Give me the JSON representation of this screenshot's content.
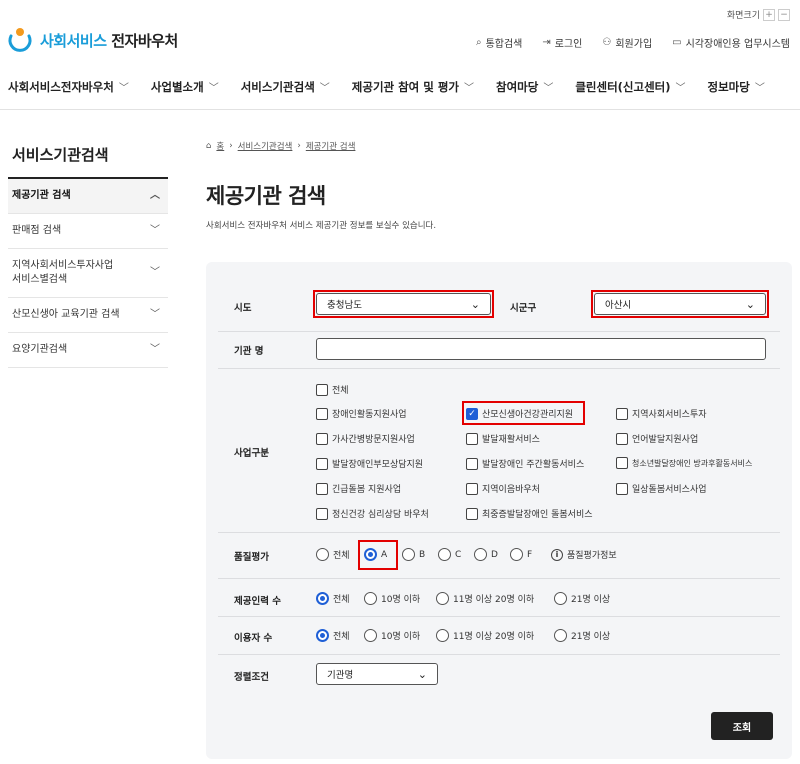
{
  "header": {
    "screen_size_label": "화면크기",
    "zoom_in": "+",
    "zoom_out": "−",
    "logo_part1": "사회서비스",
    "logo_part2": "전자바우처",
    "util": [
      {
        "icon": "search-icon",
        "glyph": "⌕",
        "label": "통합검색"
      },
      {
        "icon": "login-icon",
        "glyph": "⇥",
        "label": "로그인"
      },
      {
        "icon": "user-add-icon",
        "glyph": "⚇",
        "label": "회원가입"
      },
      {
        "icon": "monitor-icon",
        "glyph": "▭",
        "label": "시각장애인용 업무시스템"
      }
    ]
  },
  "nav": [
    "사회서비스전자바우처",
    "사업별소개",
    "서비스기관검색",
    "제공기관 참여 및 평가",
    "참여마당",
    "클린센터(신고센터)",
    "정보마당"
  ],
  "sidebar": {
    "title": "서비스기관검색",
    "items": [
      {
        "label": "제공기관 검색",
        "chevron": "︿"
      },
      {
        "label": "판매점 검색",
        "chevron": "﹀"
      },
      {
        "label": "지역사회서비스투자사업\n서비스별검색",
        "chevron": "﹀"
      },
      {
        "label": "산모신생아 교육기관 검색",
        "chevron": "﹀"
      },
      {
        "label": "요양기관검색",
        "chevron": "﹀"
      }
    ]
  },
  "breadcrumb": [
    "홈",
    "서비스기관검색",
    "제공기관 검색"
  ],
  "page": {
    "title": "제공기관 검색",
    "description": "사회서비스 전자바우처 서비스 제공기관 정보를 보실수 있습니다."
  },
  "form": {
    "sido_label": "시도",
    "sido_value": "충청남도",
    "sigungu_label": "시군구",
    "sigungu_value": "아산시",
    "org_name_label": "기관 명",
    "org_name_value": "",
    "biz_label": "사업구분",
    "biz_options": [
      {
        "label": "전체",
        "checked": false
      },
      {
        "label": "장애인활동지원사업",
        "checked": false
      },
      {
        "label": "산모신생아건강관리지원",
        "checked": true
      },
      {
        "label": "지역사회서비스투자",
        "checked": false
      },
      {
        "label": "가사간병방문지원사업",
        "checked": false
      },
      {
        "label": "발달재활서비스",
        "checked": false
      },
      {
        "label": "언어발달지원사업",
        "checked": false
      },
      {
        "label": "발달장애인부모상담지원",
        "checked": false
      },
      {
        "label": "발달장애인 주간활동서비스",
        "checked": false
      },
      {
        "label": "청소년발달장애인 방과후활동서비스",
        "checked": false
      },
      {
        "label": "긴급돌봄 지원사업",
        "checked": false
      },
      {
        "label": "지역이음바우처",
        "checked": false
      },
      {
        "label": "일상돌봄서비스사업",
        "checked": false
      },
      {
        "label": "정신건강 심리상담 바우처",
        "checked": false
      },
      {
        "label": "최중증발달장애인 돌봄서비스",
        "checked": false
      }
    ],
    "quality_label": "품질평가",
    "quality_options": [
      {
        "label": "전체",
        "checked": false
      },
      {
        "label": "A",
        "checked": true
      },
      {
        "label": "B",
        "checked": false
      },
      {
        "label": "C",
        "checked": false
      },
      {
        "label": "D",
        "checked": false
      },
      {
        "label": "F",
        "checked": false
      }
    ],
    "quality_info": "품질평가정보",
    "staff_label": "제공인력 수",
    "staff_options": [
      {
        "label": "전체",
        "checked": true
      },
      {
        "label": "10명 이하",
        "checked": false
      },
      {
        "label": "11명 이상 20명 이하",
        "checked": false
      },
      {
        "label": "21명 이상",
        "checked": false
      }
    ],
    "users_label": "이용자 수",
    "users_options": [
      {
        "label": "전체",
        "checked": true
      },
      {
        "label": "10명 이하",
        "checked": false
      },
      {
        "label": "11명 이상 20명 이하",
        "checked": false
      },
      {
        "label": "21명 이상",
        "checked": false
      }
    ],
    "sort_label": "정렬조건",
    "sort_value": "기관명",
    "search_button": "조회"
  },
  "colors": {
    "brand_blue": "#1a9dd9",
    "brand_orange": "#f39a1e",
    "check_blue": "#1f5fd6",
    "highlight_red": "#e30000"
  }
}
